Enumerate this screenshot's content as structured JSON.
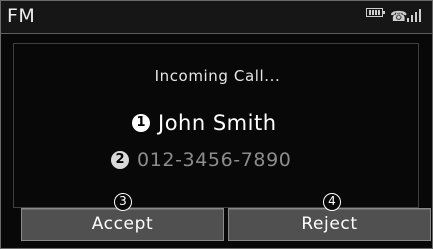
{
  "status_bar": {
    "mode": "FM",
    "icons": [
      "battery-icon",
      "bluetooth-phone-icon",
      "signal-strength-icon"
    ]
  },
  "call": {
    "headline": "Incoming Call...",
    "caller_name": "John Smith",
    "caller_number": "012-3456-7890"
  },
  "callouts": {
    "name_marker": "1",
    "number_marker": "2",
    "accept_marker": "3",
    "reject_marker": "4"
  },
  "actions": {
    "accept_label": "Accept",
    "reject_label": "Reject"
  },
  "colors": {
    "background": "#080808",
    "button": "#505050",
    "number_text": "#8c8c8c"
  }
}
